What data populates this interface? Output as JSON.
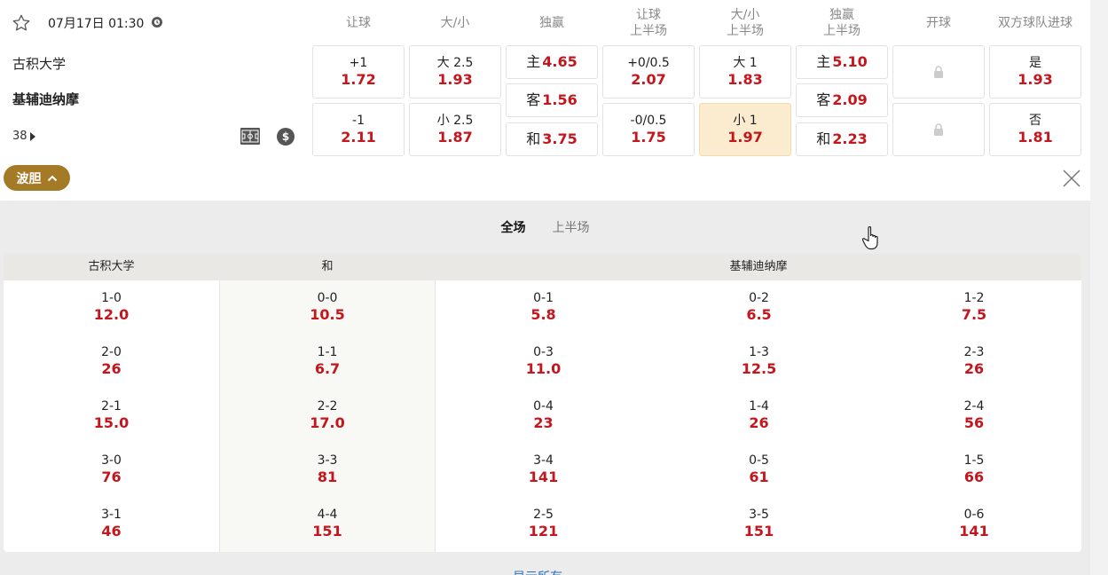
{
  "match": {
    "datetime": "07月17日 01:30",
    "home_team": "古积大学",
    "away_team": "基辅迪纳摩",
    "more_count": "38"
  },
  "headers": {
    "handicap": "让球",
    "overunder": "大/小",
    "winner": "独赢",
    "handicap_h1_a": "让球",
    "handicap_h1_b": "上半场",
    "ou_h1_a": "大/小",
    "ou_h1_b": "上半场",
    "winner_h1_a": "独赢",
    "winner_h1_b": "上半场",
    "kickoff": "开球",
    "btts": "双方球队进球"
  },
  "odds": {
    "handicap": [
      {
        "label": "+1",
        "odd": "1.72"
      },
      {
        "label": "-1",
        "odd": "2.11"
      }
    ],
    "overunder": [
      {
        "label": "大 2.5",
        "odd": "1.93"
      },
      {
        "label": "小 2.5",
        "odd": "1.87"
      }
    ],
    "winner": [
      {
        "label": "主",
        "odd": "4.65"
      },
      {
        "label": "客",
        "odd": "1.56"
      },
      {
        "label": "和",
        "odd": "3.75"
      }
    ],
    "handicap_h1": [
      {
        "label": "+0/0.5",
        "odd": "2.07"
      },
      {
        "label": "-0/0.5",
        "odd": "1.75"
      }
    ],
    "ou_h1": [
      {
        "label": "大 1",
        "odd": "1.83"
      },
      {
        "label": "小 1",
        "odd": "1.97"
      }
    ],
    "winner_h1": [
      {
        "label": "主",
        "odd": "5.10"
      },
      {
        "label": "客",
        "odd": "2.09"
      },
      {
        "label": "和",
        "odd": "2.23"
      }
    ],
    "btts": [
      {
        "label": "是",
        "odd": "1.93"
      },
      {
        "label": "否",
        "odd": "1.81"
      }
    ]
  },
  "bodan": {
    "button_label": "波胆",
    "tabs": [
      "全场",
      "上半场"
    ],
    "active_tab": "全场",
    "col_headers": {
      "home": "古积大学",
      "draw": "和",
      "away": "基辅迪纳摩"
    },
    "home": [
      {
        "score": "1-0",
        "odd": "12.0"
      },
      {
        "score": "2-0",
        "odd": "26"
      },
      {
        "score": "2-1",
        "odd": "15.0"
      },
      {
        "score": "3-0",
        "odd": "76"
      },
      {
        "score": "3-1",
        "odd": "46"
      }
    ],
    "draw": [
      {
        "score": "0-0",
        "odd": "10.5"
      },
      {
        "score": "1-1",
        "odd": "6.7"
      },
      {
        "score": "2-2",
        "odd": "17.0"
      },
      {
        "score": "3-3",
        "odd": "81"
      },
      {
        "score": "4-4",
        "odd": "151"
      }
    ],
    "away1": [
      {
        "score": "0-1",
        "odd": "5.8"
      },
      {
        "score": "0-3",
        "odd": "11.0"
      },
      {
        "score": "0-4",
        "odd": "23"
      },
      {
        "score": "3-4",
        "odd": "141"
      },
      {
        "score": "2-5",
        "odd": "121"
      }
    ],
    "away2": [
      {
        "score": "0-2",
        "odd": "6.5"
      },
      {
        "score": "1-3",
        "odd": "12.5"
      },
      {
        "score": "1-4",
        "odd": "26"
      },
      {
        "score": "0-5",
        "odd": "61"
      },
      {
        "score": "3-5",
        "odd": "151"
      }
    ],
    "away3": [
      {
        "score": "1-2",
        "odd": "7.5"
      },
      {
        "score": "2-3",
        "odd": "26"
      },
      {
        "score": "2-4",
        "odd": "56"
      },
      {
        "score": "1-5",
        "odd": "66"
      },
      {
        "score": "0-6",
        "odd": "141"
      }
    ],
    "footer_link": "显示所有"
  },
  "colors": {
    "odd_red": "#c4161c",
    "bodan_gold": "#a57a26",
    "selected_bg": "#fbecd0"
  }
}
